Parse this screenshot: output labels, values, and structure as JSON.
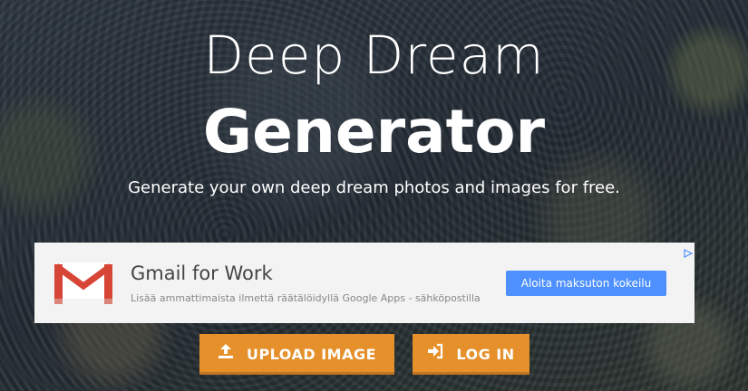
{
  "hero": {
    "title_line1": "Deep Dream",
    "title_line2": "Generator",
    "tagline": "Generate your own deep dream photos and images for free."
  },
  "ad": {
    "logo_icon": "gmail-m-icon",
    "headline": "Gmail for Work",
    "description": "Lisää ammattimaista ilmettä räätälöidyllä Google Apps - sähköpostilla",
    "cta_label": "Aloita maksuton kokeilu",
    "choices_icon": "adchoices-icon",
    "cta_color": "#4d90fe"
  },
  "actions": {
    "upload_label": "UPLOAD IMAGE",
    "upload_icon": "upload-icon",
    "login_label": "LOG IN",
    "login_icon": "sign-in-icon",
    "button_color": "#e5902b"
  }
}
